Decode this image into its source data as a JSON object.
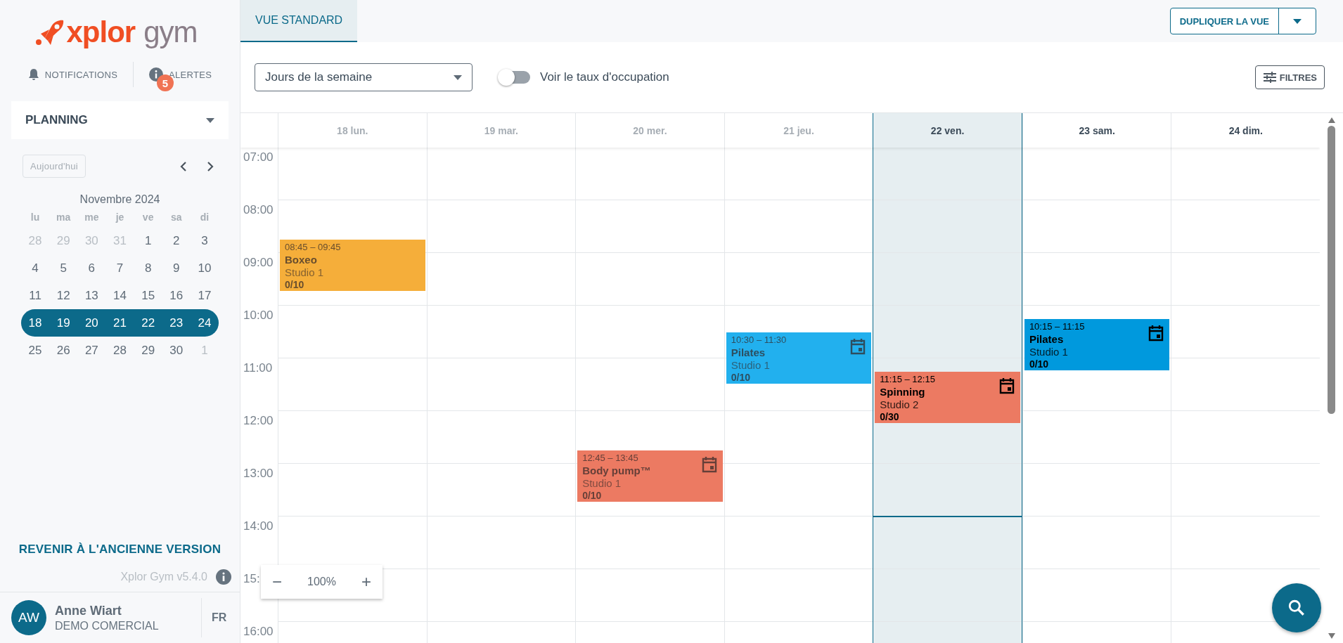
{
  "logo": {
    "brand": "xplor",
    "product": "gym"
  },
  "header_links": [
    {
      "kind": "bell",
      "label": "NOTIFICATIONS"
    },
    {
      "kind": "info",
      "label": "ALERTES",
      "badge": "5"
    }
  ],
  "module_select": {
    "value": "PLANNING"
  },
  "mini_calendar": {
    "today_button": "Aujourd'hui",
    "month": "Novembre 2024",
    "weekdays": [
      "lu",
      "ma",
      "me",
      "je",
      "ve",
      "sa",
      "di"
    ],
    "weeks": [
      {
        "selected": false,
        "days": [
          {
            "label": "28",
            "outside": true
          },
          {
            "label": "29",
            "outside": true
          },
          {
            "label": "30",
            "outside": true
          },
          {
            "label": "31",
            "outside": true
          },
          {
            "label": "1",
            "outside": false
          },
          {
            "label": "2",
            "outside": false
          },
          {
            "label": "3",
            "outside": false
          }
        ]
      },
      {
        "selected": false,
        "days": [
          {
            "label": "4",
            "outside": false
          },
          {
            "label": "5",
            "outside": false
          },
          {
            "label": "6",
            "outside": false
          },
          {
            "label": "7",
            "outside": false
          },
          {
            "label": "8",
            "outside": false
          },
          {
            "label": "9",
            "outside": false
          },
          {
            "label": "10",
            "outside": false
          }
        ]
      },
      {
        "selected": false,
        "days": [
          {
            "label": "11",
            "outside": false
          },
          {
            "label": "12",
            "outside": false
          },
          {
            "label": "13",
            "outside": false
          },
          {
            "label": "14",
            "outside": false
          },
          {
            "label": "15",
            "outside": false
          },
          {
            "label": "16",
            "outside": false
          },
          {
            "label": "17",
            "outside": false
          }
        ]
      },
      {
        "selected": true,
        "days": [
          {
            "label": "18",
            "outside": false
          },
          {
            "label": "19",
            "outside": false
          },
          {
            "label": "20",
            "outside": false
          },
          {
            "label": "21",
            "outside": false
          },
          {
            "label": "22",
            "outside": false
          },
          {
            "label": "23",
            "outside": false
          },
          {
            "label": "24",
            "outside": false
          }
        ]
      },
      {
        "selected": false,
        "days": [
          {
            "label": "25",
            "outside": false
          },
          {
            "label": "26",
            "outside": false
          },
          {
            "label": "27",
            "outside": false
          },
          {
            "label": "28",
            "outside": false
          },
          {
            "label": "29",
            "outside": false
          },
          {
            "label": "30",
            "outside": false
          },
          {
            "label": "1",
            "outside": true
          }
        ]
      }
    ]
  },
  "old_version_link": "REVENIR À L'ANCIENNE VERSION",
  "version": "Xplor Gym v5.4.0",
  "user": {
    "initials": "AW",
    "name": "Anne Wiart",
    "company": "DEMO COMERCIAL",
    "language": "FR"
  },
  "tabs": [
    {
      "label": "VUE STANDARD",
      "selected": true
    }
  ],
  "duplicate_button": "DUPLIQUER LA VUE",
  "view_select": {
    "value": "Jours de la semaine"
  },
  "occupancy_toggle": {
    "label": "Voir le taux d'occupation",
    "on": false
  },
  "filters_button": "FILTRES",
  "hours": [
    "07:00",
    "08:00",
    "09:00",
    "10:00",
    "11:00",
    "12:00",
    "13:00",
    "14:00",
    "15:",
    "16:00"
  ],
  "days": [
    {
      "label": "18 lun.",
      "past": true,
      "selected": false,
      "events": [
        {
          "time": "08:45 – 09:45",
          "title": "Boxeo",
          "room": "Studio 1",
          "count": "0/10",
          "color": "#f5ae3a",
          "calendar_icon": false
        }
      ]
    },
    {
      "label": "19 mar.",
      "past": true,
      "selected": false
    },
    {
      "label": "20 mer.",
      "past": true,
      "selected": false,
      "events": [
        {
          "time": "12:45 – 13:45",
          "title": "Body pump™",
          "room": "Studio 1",
          "count": "0/10",
          "color": "#ec7a62",
          "calendar_icon": true
        }
      ]
    },
    {
      "label": "21 jeu.",
      "past": true,
      "selected": false,
      "events": [
        {
          "time": "10:30 – 11:30",
          "title": "Pilates",
          "room": "Studio 1",
          "count": "0/10",
          "color": "#22b0ee",
          "calendar_icon": true
        }
      ]
    },
    {
      "label": "22 ven.",
      "past": false,
      "selected": true,
      "events": [
        {
          "time": "11:15 – 12:15",
          "title": "Spinning",
          "room": "Studio 2",
          "count": "0/30",
          "color": "#ec7a62",
          "calendar_icon": true
        }
      ]
    },
    {
      "label": "23 sam.",
      "past": false,
      "selected": false,
      "events": [
        {
          "time": "10:15 – 11:15",
          "title": "Pilates",
          "room": "Studio 1",
          "count": "0/10",
          "color": "#0099dd",
          "calendar_icon": true
        }
      ]
    },
    {
      "label": "24 dim.",
      "past": false,
      "selected": false
    }
  ],
  "zoom": {
    "value": "100%",
    "minus": "−",
    "plus": "+"
  }
}
